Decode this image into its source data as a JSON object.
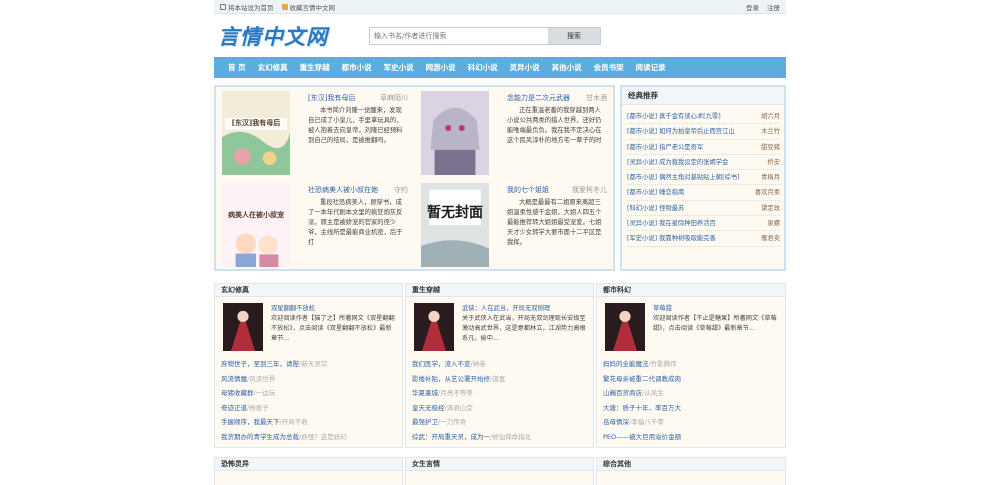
{
  "topbar": {
    "set_home": "将本站设为首页",
    "bookmark": "收藏言情中文网",
    "login": "登录",
    "register": "注册"
  },
  "logo": "言情中文网",
  "search": {
    "placeholder": "输入书名/作者进行搜索",
    "button": "搜索"
  },
  "nav": [
    "首 页",
    "玄幻修真",
    "重生穿越",
    "都市小说",
    "军史小说",
    "网游小说",
    "科幻小说",
    "灵异小说",
    "其他小说",
    "会员书架",
    "阅读记录"
  ],
  "featured": [
    {
      "title": "[东汉]我有母后",
      "author": "草麻陌川",
      "desc": "本书简介刘隆一觉醒来，发现自己成了小皇儿，手里拿玩具的，被人抱着去向皇帝，刘隆已经预料到自己的结局，是被推翻吗。",
      "cover_text": "[东汉]我有母后"
    },
    {
      "title": "念能力是二次元武器",
      "author": "甘木酒",
      "desc": "正在重温老番的我穿越到两人小说公共两类的猎人世界，还好仍能唯端最负负。我在我不定决心在这个民风淳朴的地方宅一辈子的时",
      "cover_text": ""
    },
    {
      "title": "社恐病美人被小叔在她",
      "author": "守约",
      "desc": "重段社恐病美人，顾穿书，成了一本年代剧本文里的疯狂炮灰反派，原主是被娇宠的官家的侄少爷，主线所是最能商业机密，后于打",
      "cover_text": "病美人在被小叔宠"
    },
    {
      "title": "我的七个姐姐",
      "author": "我爱柯冬儿",
      "desc": "大概是最最有二姐原来离超三姐温柔性感千金姐，大姐人四五个最能推荐转大姐姐最受宠爱。七姐天才少女转学大要市面十二平区是我挥。",
      "cover_text": "暂无封面"
    }
  ],
  "recommend": {
    "title": "经典推荐",
    "items": [
      {
        "title": "[都市小说] 真千金有读心术[九零]",
        "author": "胡六月"
      },
      {
        "title": "[都市小说] 如何为拍皇帝后止而宫江山",
        "author": "木兰竹"
      },
      {
        "title": "[都市小说] 指尸老公是奇军",
        "author": "甜豆猪"
      },
      {
        "title": "[灵异小说] 成为裁我设定的张嫣学会",
        "author": "桥安"
      },
      {
        "title": "[都市小说] 偶然主角对基贴贴上朝[综书]",
        "author": "青梅月"
      },
      {
        "title": "[都市小说] 睡恋指南",
        "author": "喜欢月柔"
      },
      {
        "title": "[科幻小说] 怪物最苏",
        "author": "黛定玫"
      },
      {
        "title": "[灵异小说] 我在星际种田养活百",
        "author": "泉螺"
      },
      {
        "title": "[军史小说] 我靠种树吸取能完善",
        "author": "雁君卖"
      }
    ]
  },
  "categories": [
    {
      "name": "玄幻修真",
      "book": "双星翻翻不放松",
      "desc": "欢迎阅读作者【猫了之】所著网文《双星翻翻不放松》，点击阅读《双星翻翻不放松》最新章节...",
      "items": [
        {
          "title": "庶物世子，至到三年，请陛",
          "sub": "新天灵宗"
        },
        {
          "title": "风流情魔",
          "sub": "风流世界"
        },
        {
          "title": "母猪收藏群",
          "sub": "一边玩"
        },
        {
          "title": "奇迹正道",
          "sub": "杨兽子"
        },
        {
          "title": "手握顺序，我最天下",
          "sub": "开局不收"
        },
        {
          "title": "我货期办的青学生成为总裁",
          "sub": "妖怪？这是妖幻"
        }
      ]
    },
    {
      "name": "重生穿越",
      "book": "武侠：人在武当，开局无双侧理",
      "desc": "关于武侠人在武当，开局无双剑理现长安级至激动高武世界，这是意都林立，江湖势力高根系凡，偷中...",
      "items": [
        {
          "title": "我们医学，流入不变",
          "sub": "钟卷"
        },
        {
          "title": "影楼补贴，从艺公署开始修",
          "sub": "道富"
        },
        {
          "title": "华夏墨城",
          "sub": "月亮不等等"
        },
        {
          "title": "皇天无极经",
          "sub": "满君山堂"
        },
        {
          "title": "最强护卫",
          "sub": "一刀传奇"
        },
        {
          "title": "综武：开局重天灵，成为一",
          "sub": "修仙保命指北"
        }
      ]
    },
    {
      "name": "都市科幻",
      "book": "草莓甜",
      "desc": "欢迎阅读作者【不止是糖果】所著网文《草莓甜》，点击阅读《草莓甜》最新章节...",
      "items": [
        {
          "title": "妈妈的全能魔法",
          "sub": "竹影腾传"
        },
        {
          "title": "繁花母亲被重二代调教成肉",
          "sub": ""
        },
        {
          "title": "山巍百货商店",
          "sub": "从风生"
        },
        {
          "title": "大唐：质子十年，率百万大",
          "sub": ""
        },
        {
          "title": "岳母情深",
          "sub": "李福八千零"
        },
        {
          "title": "PEO——被大巨用溢价金额",
          "sub": ""
        }
      ]
    }
  ],
  "bottom_categories": [
    "恐怖灵异",
    "女生言情",
    "综合其他"
  ]
}
